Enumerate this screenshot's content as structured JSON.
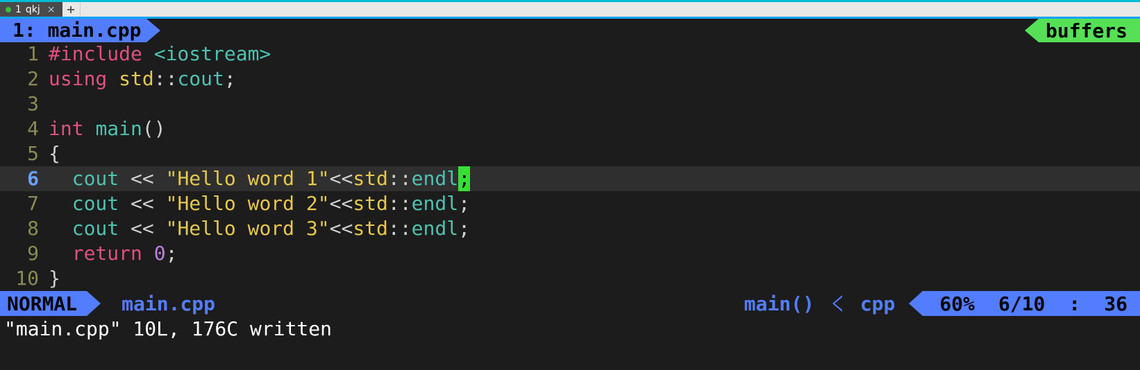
{
  "window": {
    "tabs": [
      {
        "index": "1",
        "title": "qkj"
      }
    ],
    "new_tab_glyph": "+"
  },
  "bufferline": {
    "active_index": "1:",
    "active_name": "main.cpp",
    "right_label": "buffers"
  },
  "code": {
    "cursor_line": 6,
    "lines": [
      {
        "n": 1,
        "tokens": [
          {
            "c": "tk-pre",
            "t": "#include "
          },
          {
            "c": "tk-inc",
            "t": "<iostream>"
          }
        ]
      },
      {
        "n": 2,
        "tokens": [
          {
            "c": "tk-kw",
            "t": "using "
          },
          {
            "c": "tk-type",
            "t": "std"
          },
          {
            "c": "tk-punc",
            "t": "::"
          },
          {
            "c": "tk-func",
            "t": "cout"
          },
          {
            "c": "tk-punc",
            "t": ";"
          }
        ]
      },
      {
        "n": 3,
        "tokens": []
      },
      {
        "n": 4,
        "tokens": [
          {
            "c": "tk-kw",
            "t": "int "
          },
          {
            "c": "tk-func",
            "t": "main"
          },
          {
            "c": "tk-punc",
            "t": "()"
          }
        ]
      },
      {
        "n": 5,
        "tokens": [
          {
            "c": "tk-punc",
            "t": "{"
          }
        ]
      },
      {
        "n": 6,
        "tokens": [
          {
            "c": "tk-punc",
            "t": "  "
          },
          {
            "c": "tk-func",
            "t": "cout"
          },
          {
            "c": "tk-op",
            "t": " << "
          },
          {
            "c": "tk-str",
            "t": "\"Hello word 1\""
          },
          {
            "c": "tk-op",
            "t": "<<"
          },
          {
            "c": "tk-type",
            "t": "std"
          },
          {
            "c": "tk-punc",
            "t": "::"
          },
          {
            "c": "tk-inc",
            "t": "endl"
          },
          {
            "c": "cursor-block",
            "t": ";"
          }
        ]
      },
      {
        "n": 7,
        "tokens": [
          {
            "c": "tk-punc",
            "t": "  "
          },
          {
            "c": "tk-func",
            "t": "cout"
          },
          {
            "c": "tk-op",
            "t": " << "
          },
          {
            "c": "tk-str",
            "t": "\"Hello word 2\""
          },
          {
            "c": "tk-op",
            "t": "<<"
          },
          {
            "c": "tk-type",
            "t": "std"
          },
          {
            "c": "tk-punc",
            "t": "::"
          },
          {
            "c": "tk-inc",
            "t": "endl"
          },
          {
            "c": "tk-punc",
            "t": ";"
          }
        ]
      },
      {
        "n": 8,
        "tokens": [
          {
            "c": "tk-punc",
            "t": "  "
          },
          {
            "c": "tk-func",
            "t": "cout"
          },
          {
            "c": "tk-op",
            "t": " << "
          },
          {
            "c": "tk-str",
            "t": "\"Hello word 3\""
          },
          {
            "c": "tk-op",
            "t": "<<"
          },
          {
            "c": "tk-type",
            "t": "std"
          },
          {
            "c": "tk-punc",
            "t": "::"
          },
          {
            "c": "tk-inc",
            "t": "endl"
          },
          {
            "c": "tk-punc",
            "t": ";"
          }
        ]
      },
      {
        "n": 9,
        "tokens": [
          {
            "c": "tk-punc",
            "t": "  "
          },
          {
            "c": "tk-kw",
            "t": "return "
          },
          {
            "c": "tk-num",
            "t": "0"
          },
          {
            "c": "tk-punc",
            "t": ";"
          }
        ]
      },
      {
        "n": 10,
        "tokens": [
          {
            "c": "tk-punc",
            "t": "}"
          }
        ]
      }
    ]
  },
  "airline": {
    "mode": "NORMAL",
    "file": "main.cpp",
    "context": "main()",
    "filetype": "cpp",
    "percent": "60%",
    "line_total": "6/10",
    "col_sep": ":",
    "col": "36"
  },
  "cmdline": "\"main.cpp\" 10L, 176C written"
}
